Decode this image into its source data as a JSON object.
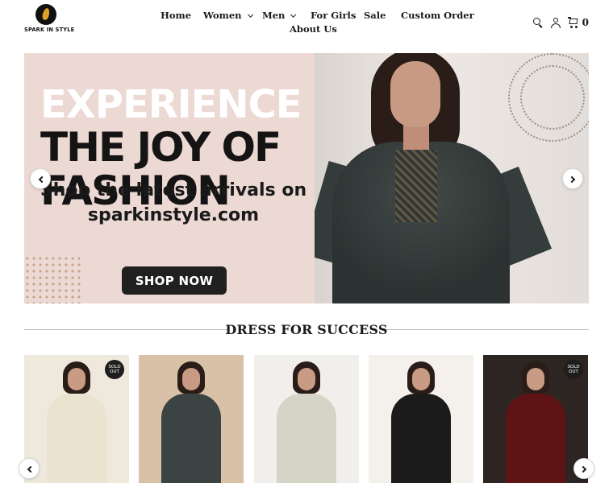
{
  "brand": {
    "logo_text": "SPARK IN STYLE"
  },
  "nav": {
    "home": "Home",
    "women": "Women",
    "men": "Men",
    "for_girls": "For Girls",
    "sale": "Sale",
    "custom_order": "Custom Order",
    "about_us": "About Us"
  },
  "header": {
    "cart_count": "0",
    "icons": [
      "search-icon",
      "account-icon",
      "cart-icon"
    ]
  },
  "hero": {
    "line1": "EXPERIENCE",
    "line2": "THE JOY OF",
    "line3": "FASHION",
    "sub1": "Shop the latest arrivals on",
    "sub2": "sparkinstyle.com",
    "button": "SHOP NOW"
  },
  "section": {
    "title": "DRESS FOR SUCCESS"
  },
  "products": [
    {
      "badge": "SOLD OUT",
      "sold_out": true,
      "colors": {
        "bg": "#efe9dd",
        "outfit": "#e9e3cf"
      }
    },
    {
      "badge": "",
      "sold_out": false,
      "colors": {
        "bg": "#d8c1a6",
        "outfit": "#3c4443"
      }
    },
    {
      "badge": "",
      "sold_out": false,
      "colors": {
        "bg": "#f1efeb",
        "outfit": "#d6d3c7"
      }
    },
    {
      "badge": "",
      "sold_out": false,
      "colors": {
        "bg": "#f4f1ec",
        "outfit": "#1b1b1b"
      }
    },
    {
      "badge": "SOLD OUT",
      "sold_out": true,
      "colors": {
        "bg": "#2c2522",
        "outfit": "#5e1414"
      }
    }
  ],
  "colors": {
    "accent_dark": "#1b1b1b",
    "hero_bg": "#ecd9d3",
    "button_bg": "#202020"
  }
}
